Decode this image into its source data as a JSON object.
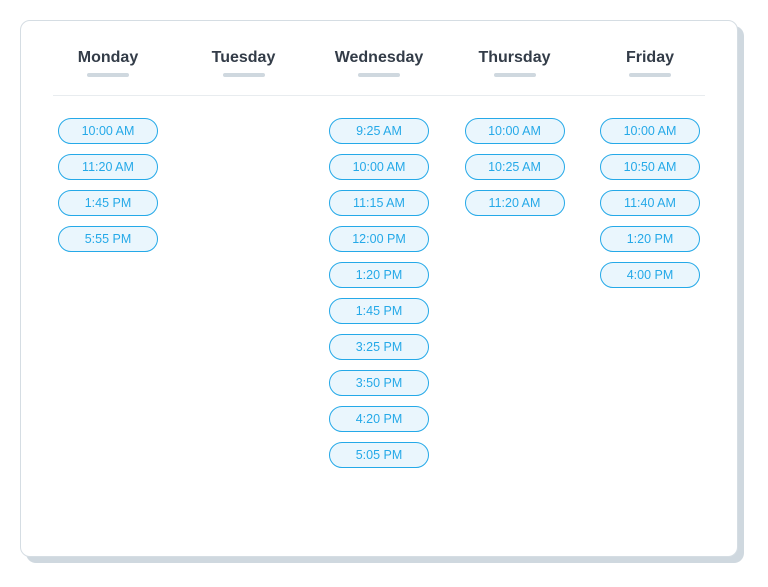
{
  "days": [
    {
      "label": "Monday",
      "slots": [
        "10:00 AM",
        "11:20 AM",
        "1:45 PM",
        "5:55 PM"
      ]
    },
    {
      "label": "Tuesday",
      "slots": []
    },
    {
      "label": "Wednesday",
      "slots": [
        "9:25 AM",
        "10:00 AM",
        "11:15 AM",
        "12:00 PM",
        "1:20 PM",
        "1:45 PM",
        "3:25 PM",
        "3:50 PM",
        "4:20 PM",
        "5:05 PM"
      ]
    },
    {
      "label": "Thursday",
      "slots": [
        "10:00 AM",
        "10:25 AM",
        "11:20 AM"
      ]
    },
    {
      "label": "Friday",
      "slots": [
        "10:00 AM",
        "10:50 AM",
        "11:40 AM",
        "1:20 PM",
        "4:00 PM"
      ]
    }
  ]
}
